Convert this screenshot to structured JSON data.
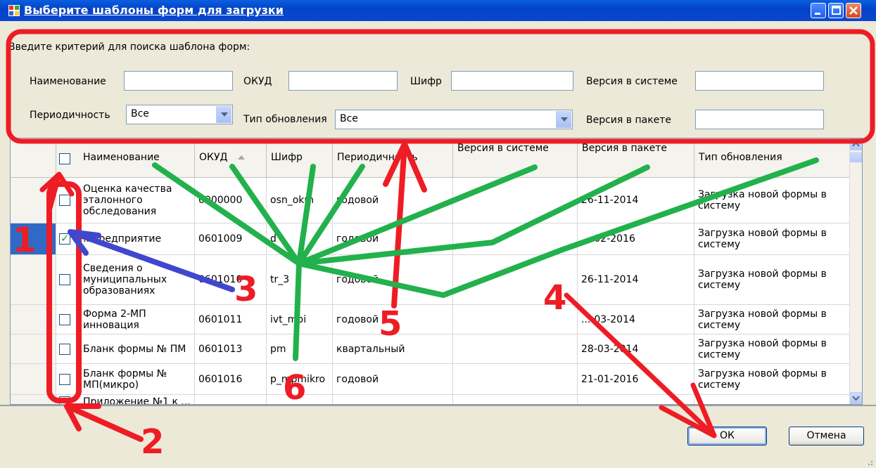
{
  "window": {
    "title": "Выберите шаблоны форм для загрузки"
  },
  "search": {
    "caption": "Введите критерий для поиска шаблона форм:",
    "name_label": "Наименование",
    "name_value": "",
    "okud_label": "ОКУД",
    "okud_value": "",
    "code_label": "Шифр",
    "code_value": "",
    "version_sys_label": "Версия в системе",
    "version_sys_value": "",
    "periodicity_label": "Периодичность",
    "periodicity_value": "Все",
    "update_type_label": "Тип обновления",
    "update_type_value": "Все",
    "version_pkg_label": "Версия в пакете",
    "version_pkg_value": ""
  },
  "grid": {
    "columns": [
      "Наименование",
      "ОКУД",
      "Шифр",
      "Периодичность",
      "Версия в системе",
      "Версия в пакете",
      "Тип обновления"
    ],
    "rows": [
      {
        "checked": false,
        "name": "Оценка качества эталонного обследования",
        "okud": "0000000",
        "code": "osn_okm",
        "period": "годовой",
        "ver_sys": "",
        "ver_pkg": "26-11-2014",
        "update": "Загрузка новой формы в систему"
      },
      {
        "checked": true,
        "name": "...предприятие",
        "okud": "0601009",
        "code": "d",
        "period": "годовой",
        "ver_sys": "",
        "ver_pkg": "...-02-2016",
        "update": "Загрузка новой формы в систему"
      },
      {
        "checked": false,
        "name": "Сведения о муниципальных образованиях",
        "okud": "0601010",
        "code": "tr_3",
        "period": "годовой",
        "ver_sys": "",
        "ver_pkg": "26-11-2014",
        "update": "Загрузка новой формы в систему"
      },
      {
        "checked": false,
        "name": "Форма 2-МП инновация",
        "okud": "0601011",
        "code": "ivt_mpi",
        "period": "годовой",
        "ver_sys": "",
        "ver_pkg": "...-03-2014",
        "update": "Загрузка новой формы в систему"
      },
      {
        "checked": false,
        "name": "Бланк формы № ПМ",
        "okud": "0601013",
        "code": "pm",
        "period": "квартальный",
        "ver_sys": "",
        "ver_pkg": "28-03-2014",
        "update": "Загрузка новой формы в систему"
      },
      {
        "checked": false,
        "name": "Бланк формы № МП(микро)",
        "okud": "0601016",
        "code": "p_mpmikro",
        "period": "годовой",
        "ver_sys": "",
        "ver_pkg": "21-01-2016",
        "update": "Загрузка новой формы в систему"
      },
      {
        "checked": false,
        "name": "Приложение №1 к ...",
        "okud": "",
        "code": "",
        "period": "",
        "ver_sys": "",
        "ver_pkg": "",
        "update": ""
      }
    ]
  },
  "buttons": {
    "ok": "ОК",
    "cancel": "Отмена"
  },
  "annotations": [
    "1",
    "2",
    "3",
    "4",
    "5",
    "6"
  ],
  "colors": {
    "annotation_red": "#ee1c24",
    "annotation_green": "#22b14c",
    "annotation_blue": "#3f48cc",
    "titlebar": "#0a46cf"
  }
}
